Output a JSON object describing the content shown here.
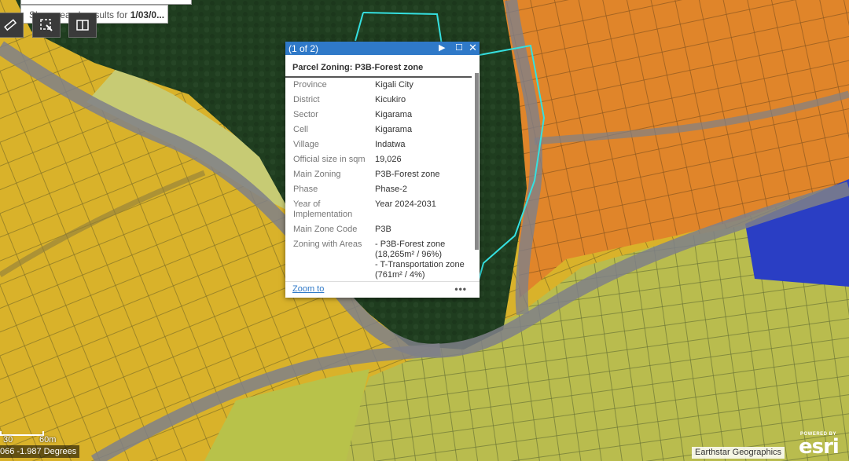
{
  "search": {
    "suggestion_prefix": "Show search results for ",
    "suggestion_query": "1/03/0..."
  },
  "toolbar": {
    "buttons": [
      {
        "name": "measure-ruler-icon"
      },
      {
        "name": "select-feature-icon"
      },
      {
        "name": "compare-layers-icon"
      }
    ]
  },
  "popup": {
    "counter": "(1 of 2)",
    "title": "Parcel Zoning: P3B-Forest zone",
    "attributes": [
      {
        "label": "Province",
        "value": "Kigali City"
      },
      {
        "label": "District",
        "value": "Kicukiro"
      },
      {
        "label": "Sector",
        "value": "Kigarama"
      },
      {
        "label": "Cell",
        "value": "Kigarama"
      },
      {
        "label": "Village",
        "value": "Indatwa"
      },
      {
        "label": "Official size in sqm",
        "value": "19,026"
      },
      {
        "label": "Main Zoning",
        "value": "P3B-Forest zone"
      },
      {
        "label": "Phase",
        "value": "Phase-2"
      },
      {
        "label": "Year of Implementation",
        "value": "Year 2024-2031"
      },
      {
        "label": "Main Zone Code",
        "value": "P3B"
      },
      {
        "label": "Zoning with Areas",
        "value": "- P3B-Forest zone (18,265m² / 96%)\n- T-Transportation zone (761m² / 4%)"
      }
    ],
    "zoom_link": "Zoom to",
    "more_icon": "•••"
  },
  "scale": {
    "left_label": "30",
    "right_label": "60m"
  },
  "coordinates": "066 -1.987 Degrees",
  "attribution": "Earthstar Geographics",
  "logo": {
    "powered_by": "POWERED BY",
    "brand": "esri"
  },
  "colors": {
    "forest_zone": "#1f3d1f",
    "residential_zone": "#d9b22a",
    "commercial_zone": "#e0852a",
    "agricultural_zone": "#b9bc4e",
    "industrial_zone": "#2a3ec4",
    "road": "#7f8088",
    "highlight_outline": "#35e0e0",
    "popup_header": "#2f79c8"
  }
}
